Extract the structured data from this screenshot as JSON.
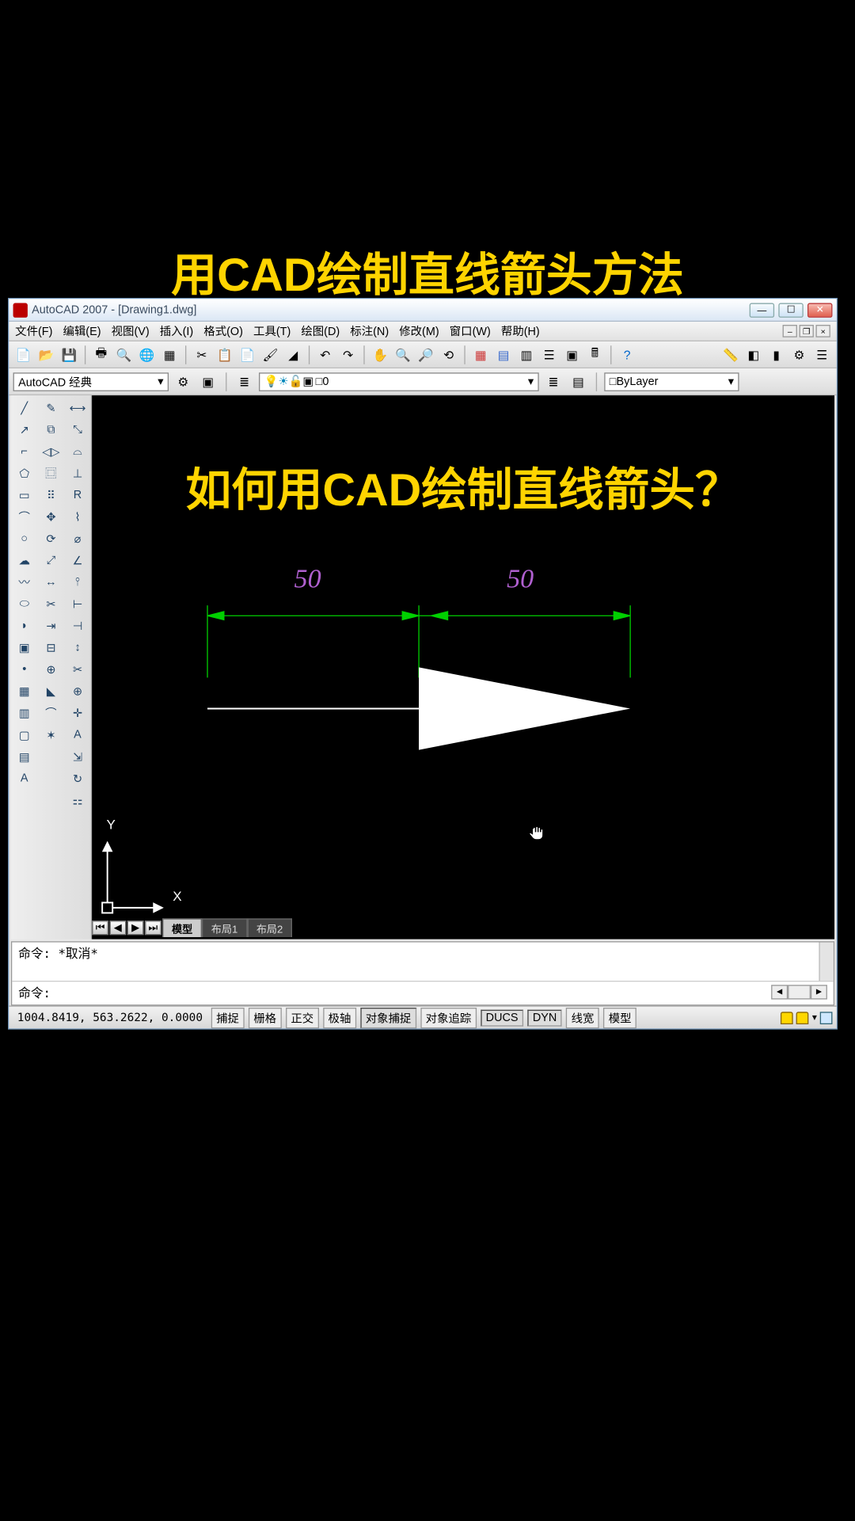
{
  "captions": {
    "top": "用CAD绘制直线箭头方法",
    "question": "如何用CAD绘制直线箭头？"
  },
  "window_title": "AutoCAD 2007 - [Drawing1.dwg]",
  "menus": [
    "文件(F)",
    "编辑(E)",
    "视图(V)",
    "插入(I)",
    "格式(O)",
    "工具(T)",
    "绘图(D)",
    "标注(N)",
    "修改(M)",
    "窗口(W)",
    "帮助(H)"
  ],
  "workspace": "AutoCAD 经典",
  "layer_combo": {
    "prefix_icons": "💡❄🔒",
    "swatch": "□",
    "text": " 0"
  },
  "bylayer_label": "ByLayer",
  "drawing": {
    "dim1": "50",
    "dim2": "50",
    "axis_x": "X",
    "axis_y": "Y"
  },
  "tabs": {
    "model": "模型",
    "layout1": "布局1",
    "layout2": "布局2"
  },
  "command": {
    "history": "命令: *取消*",
    "prompt": "命令:"
  },
  "status": {
    "coord": "1004.8419, 563.2622, 0.0000",
    "buttons": [
      "捕捉",
      "栅格",
      "正交",
      "极轴",
      "对象捕捉",
      "对象追踪",
      "DUCS",
      "DYN",
      "线宽",
      "模型"
    ]
  }
}
